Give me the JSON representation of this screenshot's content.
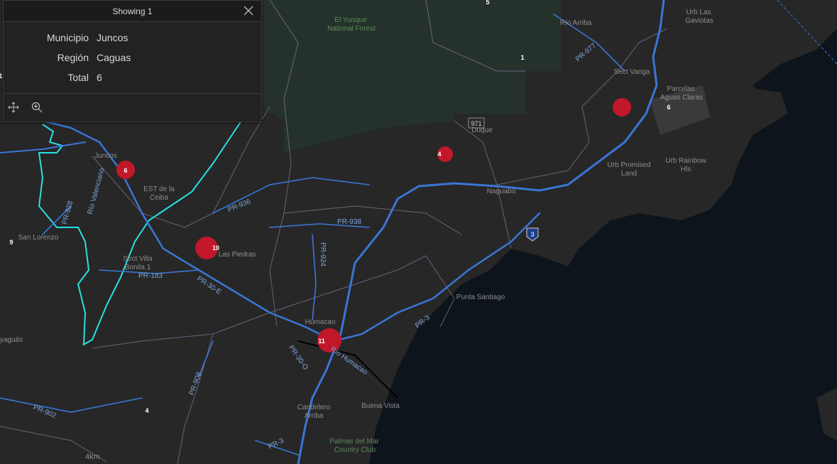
{
  "popup": {
    "title": "Showing 1",
    "fields": [
      {
        "label": "Municipio",
        "value": "Juncos"
      },
      {
        "label": "Región",
        "value": "Caguas"
      },
      {
        "label": "Total",
        "value": "6"
      }
    ],
    "icons": {
      "close": "close-icon",
      "pan": "pan-icon",
      "zoom": "zoom-in-icon"
    }
  },
  "map": {
    "place_labels": [
      "El Yunque",
      "National Forest",
      "Río Arriba",
      "Urb Las",
      "Gaviotas",
      "Sect Vanga",
      "Parcelas",
      "Aguas Claras",
      "Duque",
      "Juncos",
      "EST de la",
      "Ceiba",
      "Naguabo",
      "Urb Promised",
      "Land",
      "Urb Rainbow",
      "Hls",
      "San Lorenzo",
      "Sect Villa",
      "Bonita 1",
      "Las Piedras",
      "Punta Santiago",
      "Humacao",
      "Río Humacao",
      "Río Valenciano",
      "Candelero",
      "Arriba",
      "Buena Vista",
      "Palmas del Mar",
      "Country Club",
      "yaguás"
    ],
    "road_labels": [
      "PR-977",
      "PR-936",
      "PR-938",
      "PR-924",
      "PR-928",
      "PR-183",
      "PR-30-E",
      "PR-30-O",
      "PR-3",
      "PR-908",
      "PR-902",
      "PR-3"
    ],
    "route_shields": [
      "971",
      "3"
    ],
    "cluster_markers": [
      {
        "label": "6",
        "municipio": "Juncos"
      },
      {
        "label": "10",
        "municipio": "Las Piedras"
      },
      {
        "label": "11",
        "municipio": "Humacao"
      },
      {
        "label": "4",
        "municipio": "Naguabo"
      },
      {
        "label": "",
        "municipio": "Ceiba"
      }
    ],
    "count_labels": [
      "5",
      "1",
      "6",
      "9",
      "4",
      "1"
    ],
    "scale_label": "4km",
    "colors": {
      "background_water": "#0d141b",
      "land": "#262626",
      "forest": "#22302a",
      "highway": "#3a76d6",
      "boundary": "#8a7a9e",
      "selection": "#29e0e0",
      "marker": "#c0182a"
    }
  }
}
